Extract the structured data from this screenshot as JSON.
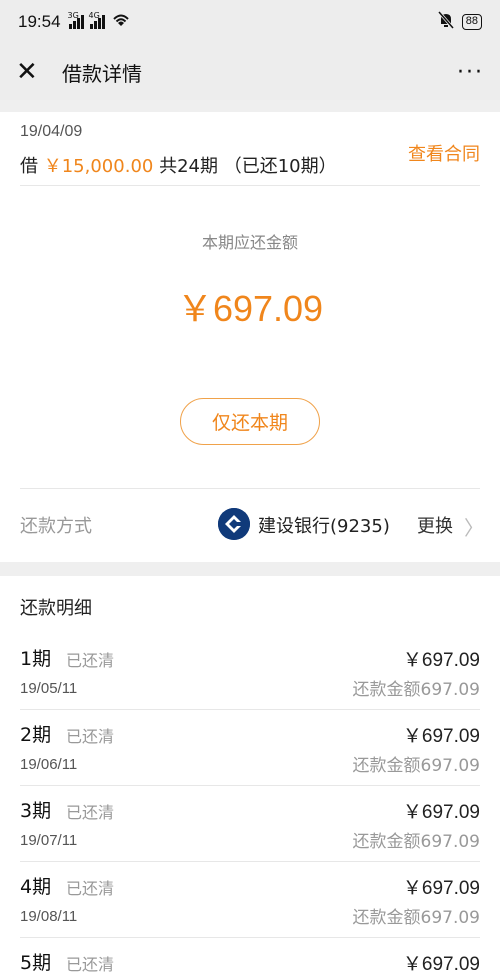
{
  "status_bar": {
    "time": "19:54",
    "net1": "3G",
    "net2": "4G",
    "battery": "88"
  },
  "nav": {
    "title": "借款详情",
    "close_icon": "close-icon",
    "more": "···"
  },
  "loan": {
    "date": "19/04/09",
    "prefix": "借 ",
    "amount": "￥15,000.00",
    "terms": " 共24期 （已还10期）",
    "contract_link": "查看合同"
  },
  "due": {
    "label": "本期应还金额",
    "amount": "￥697.09"
  },
  "pay_button": "仅还本期",
  "method": {
    "label": "还款方式",
    "bank": "建设银行(9235)",
    "change": "更换",
    "chevron": "〉"
  },
  "records": {
    "title": "还款明细",
    "items": [
      {
        "period": "1期",
        "status": "已还清",
        "date": "19/05/11",
        "amount": "￥697.09",
        "paid": "还款金额697.09"
      },
      {
        "period": "2期",
        "status": "已还清",
        "date": "19/06/11",
        "amount": "￥697.09",
        "paid": "还款金额697.09"
      },
      {
        "period": "3期",
        "status": "已还清",
        "date": "19/07/11",
        "amount": "￥697.09",
        "paid": "还款金额697.09"
      },
      {
        "period": "4期",
        "status": "已还清",
        "date": "19/08/11",
        "amount": "￥697.09",
        "paid": "还款金额697.09"
      },
      {
        "period": "5期",
        "status": "已还清",
        "date": "",
        "amount": "￥697.09",
        "paid": ""
      }
    ]
  },
  "colors": {
    "accent": "#f0861c",
    "bank_blue": "#103a7a"
  }
}
